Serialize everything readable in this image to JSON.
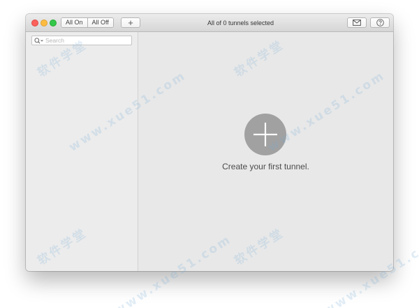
{
  "toolbar": {
    "all_on_label": "All On",
    "all_off_label": "All Off",
    "add_label": "+",
    "title": "All of 0 tunnels selected"
  },
  "sidebar": {
    "search": {
      "placeholder": "Search",
      "value": ""
    }
  },
  "main": {
    "empty_message": "Create your first tunnel."
  },
  "icons": {
    "window_close": "close-icon",
    "window_minimize": "minimize-icon",
    "window_zoom": "zoom-icon",
    "add": "plus-icon",
    "feedback": "envelope-icon",
    "help": "question-icon",
    "search": "magnifier-icon",
    "create": "plus-circle-icon"
  },
  "colors": {
    "close": "#fc605b",
    "minimize": "#fdbc40",
    "zoom": "#34c84a",
    "add_circle": "#a1a1a1"
  },
  "watermark": {
    "brand": "软件学堂",
    "url": "www.xue51.com"
  }
}
